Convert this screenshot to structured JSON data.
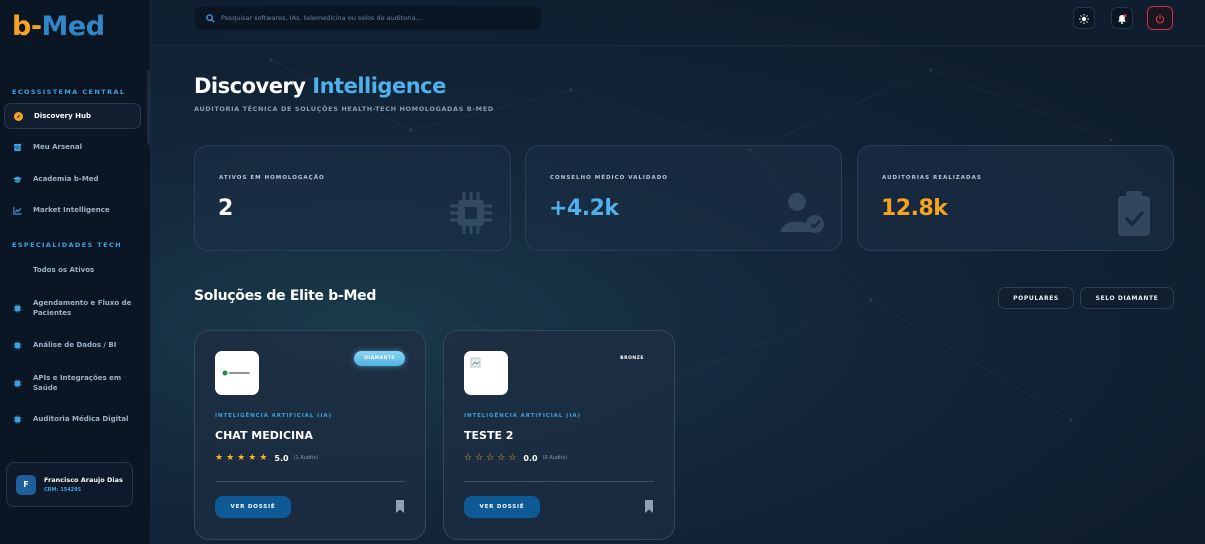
{
  "brand": {
    "part1": "b-",
    "part2": "Med"
  },
  "search": {
    "placeholder": "Pesquisar softwares, IAs, telemedicina ou selos de auditoria..."
  },
  "sidebar": {
    "section_central": "ECOSSISTEMA CENTRAL",
    "central_items": [
      {
        "label": "Discovery Hub",
        "icon": "compass-icon",
        "active": true
      },
      {
        "label": "Meu Arsenal",
        "icon": "box-icon"
      },
      {
        "label": "Academia b-Med",
        "icon": "graduation-cap-icon"
      },
      {
        "label": "Market Intelligence",
        "icon": "chart-line-icon"
      }
    ],
    "section_tech": "ESPECIALIDADES TECH",
    "tech_items": [
      {
        "label": "Todos os Ativos"
      },
      {
        "label": "Agendamento e Fluxo de Pacientes",
        "icon": "chip-icon"
      },
      {
        "label": "Análise de Dados / BI",
        "icon": "chip-icon"
      },
      {
        "label": "APIs e Integrações em Saúde",
        "icon": "chip-icon"
      },
      {
        "label": "Auditoria Médica Digital",
        "icon": "chip-icon"
      }
    ]
  },
  "user": {
    "initial": "F",
    "name": "Francisco Araujo Dias",
    "crm": "CRM: 154295"
  },
  "header": {
    "title_main": "Discovery",
    "title_accent": "Intelligence",
    "subtitle": "AUDITORIA TÉCNICA DE SOLUÇÕES HEALTH-TECH HOMOLOGADAS B-MED"
  },
  "stats": [
    {
      "label": "ATIVOS EM HOMOLOGAÇÃO",
      "value": "2",
      "color": "#ffffff",
      "icon": "chip-icon"
    },
    {
      "label": "CONSELHO MÉDICO VALIDADO",
      "value": "+4.2k",
      "color": "#4fb0ec",
      "icon": "user-check-icon"
    },
    {
      "label": "AUDITORIAS REALIZADAS",
      "value": "12.8k",
      "color": "#f7a320",
      "icon": "clipboard-check-icon"
    }
  ],
  "solutions": {
    "title": "Soluções de Elite b-Med",
    "filters": [
      "POPULARES",
      "SELO DIAMANTE"
    ]
  },
  "cards": [
    {
      "badge": "DIAMANTE",
      "category": "INTELIGÊNCIA ARTIFICIAL (IA)",
      "name": "CHAT MEDICINA",
      "stars_filled": 5,
      "score": "5.0",
      "audits": "(1 Audits)",
      "button": "VER DOSSIÊ"
    },
    {
      "badge": "BRONZE",
      "category": "INTELIGÊNCIA ARTIFICIAL (IA)",
      "name": "TESTE 2",
      "stars_filled": 0,
      "score": "0.0",
      "audits": "(0 Audits)",
      "button": "VER DOSSIÊ"
    }
  ],
  "colors": {
    "accent": "#3fa1e0",
    "brand_orange": "#f7a320",
    "star": "#f7b52a",
    "danger": "#c73642"
  }
}
